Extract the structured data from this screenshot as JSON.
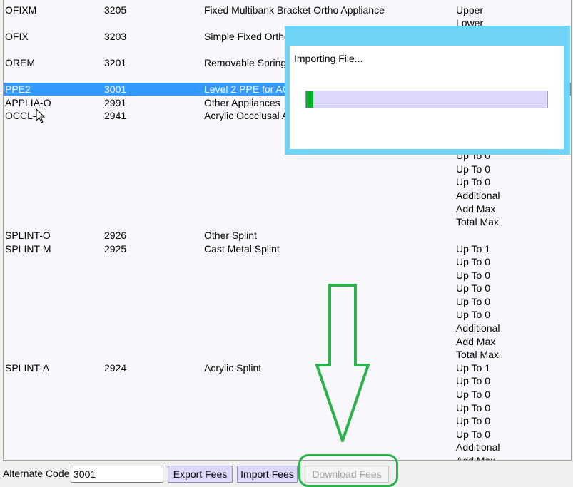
{
  "rows": [
    {
      "code": "OFIXM",
      "number": "3205",
      "description": "Fixed Multibank Bracket Ortho Appliance",
      "selected": false
    },
    {
      "code": "OFIX",
      "number": "3203",
      "description": "Simple Fixed Ortho",
      "selected": false
    },
    {
      "code": "OREM",
      "number": "3201",
      "description": "Removable Spring",
      "selected": false
    },
    {
      "code": "PPE2",
      "number": "3001",
      "description": "Level 2 PPE for AC",
      "selected": true
    },
    {
      "code": "APPLIA-O",
      "number": "2991",
      "description": "Other Appliances",
      "selected": false
    },
    {
      "code": "OCCL-",
      "number": "2941",
      "description": "Acrylic Occclusal A",
      "selected": false
    },
    {
      "code": "SPLINT-O",
      "number": "2926",
      "description": "Other Splint",
      "selected": false
    },
    {
      "code": "SPLINT-M",
      "number": "2925",
      "description": "Cast Metal Splint",
      "selected": false
    },
    {
      "code": "SPLINT-A",
      "number": "2924",
      "description": "Acrylic Splint",
      "selected": false
    }
  ],
  "limits": [
    "Upper",
    "Lower",
    "Up To 0",
    "Up To 0",
    "Up To 0",
    "Additional",
    "Add Max",
    "Total Max",
    "Up To 1",
    "Up To 0",
    "Up To 0",
    "Up To 0",
    "Up To 0",
    "Up To 0",
    "Additional",
    "Add Max",
    "Total Max",
    "Up To 1",
    "Up To 0",
    "Up To 0",
    "Up To 0",
    "Up To 0",
    "Up To 0",
    "Additional",
    "Add Max"
  ],
  "dialog": {
    "message": "Importing File...",
    "progress_fraction": 0.03
  },
  "bottom": {
    "alt_code_label": "Alternate Code",
    "alt_code_value": "3001",
    "export_label": "Export Fees",
    "import_label": "Import Fees",
    "download_label": "Download Fees"
  },
  "colors": {
    "selection": "#3399ff",
    "dialog_border": "#6ed3f7",
    "progress": "#06b025",
    "annotation": "#2bb24a"
  }
}
